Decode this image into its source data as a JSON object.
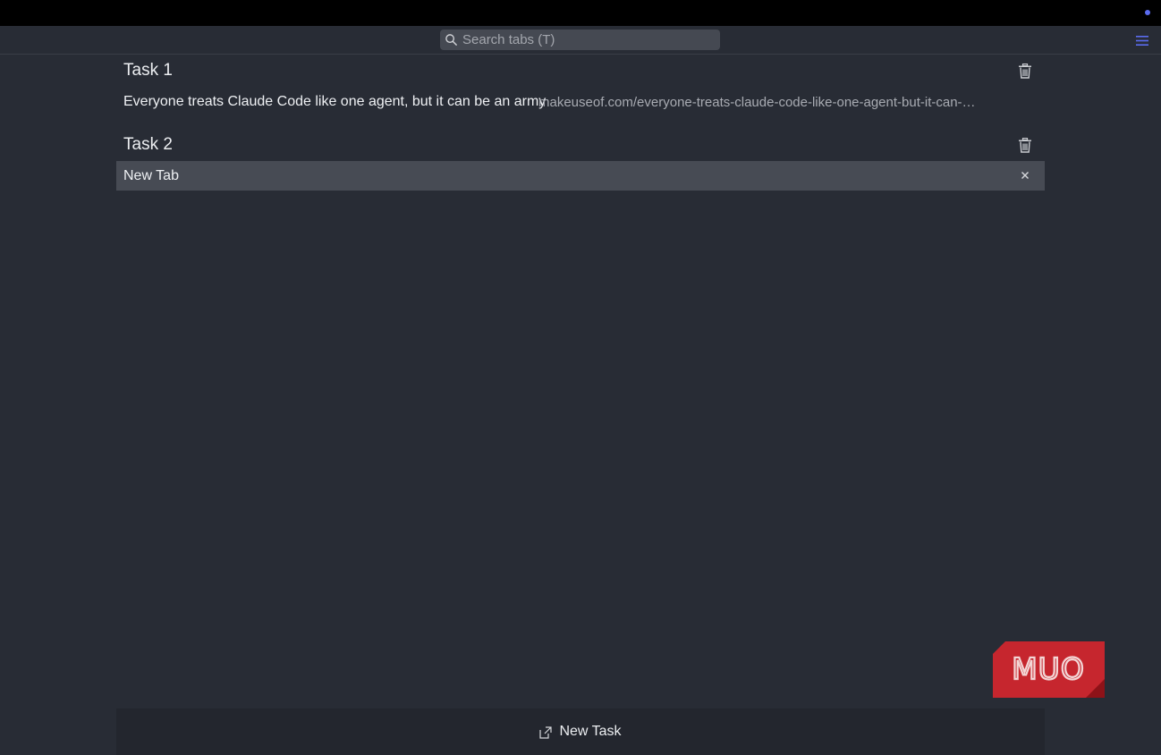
{
  "toolbar": {
    "search_placeholder": "Search tabs (T)",
    "search_value": ""
  },
  "tasks": [
    {
      "title": "Task 1",
      "tabs": [
        {
          "title": "Everyone treats Claude Code like one agent, but it can be an army",
          "url": "makeuseof.com/everyone-treats-claude-code-like-one-agent-but-it-can-…"
        }
      ]
    },
    {
      "title": "Task 2",
      "tabs": [
        {
          "title": "New Tab",
          "url": ""
        }
      ]
    }
  ],
  "footer": {
    "new_task_label": "New Task"
  },
  "watermark": {
    "text": "MUO"
  },
  "colors": {
    "background": "#282c35",
    "accent": "#5b6cf0",
    "selected_row": "#474b54",
    "watermark": "#c6262e"
  },
  "icons": [
    "search-icon",
    "menu-icon",
    "trash-icon",
    "close-icon",
    "new-task-icon"
  ]
}
